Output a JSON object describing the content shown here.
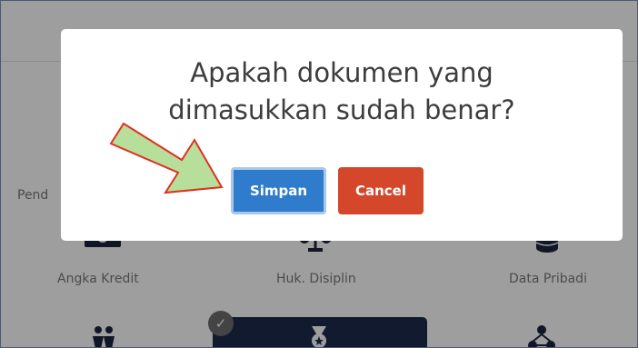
{
  "dialog": {
    "title_line1": "Apakah dokumen yang",
    "title_line2": "dimasukkan sudah benar?",
    "confirm_label": "Simpan",
    "cancel_label": "Cancel"
  },
  "menu": {
    "partial_item": "Pend",
    "items": [
      {
        "label": "Angka Kredit",
        "icon": "money-icon"
      },
      {
        "label": "Huk. Disiplin",
        "icon": "scales-icon"
      },
      {
        "label": "Data Pribadi",
        "icon": "database-icon"
      }
    ],
    "bottom_icons": [
      "family-icon",
      "medal-icon",
      "network-icon"
    ]
  },
  "colors": {
    "confirm": "#2f7ccc",
    "cancel": "#d4472b",
    "arrow_fill": "#b7de9a",
    "arrow_stroke": "#e0301e",
    "selected_tile": "#1e2b4d"
  }
}
